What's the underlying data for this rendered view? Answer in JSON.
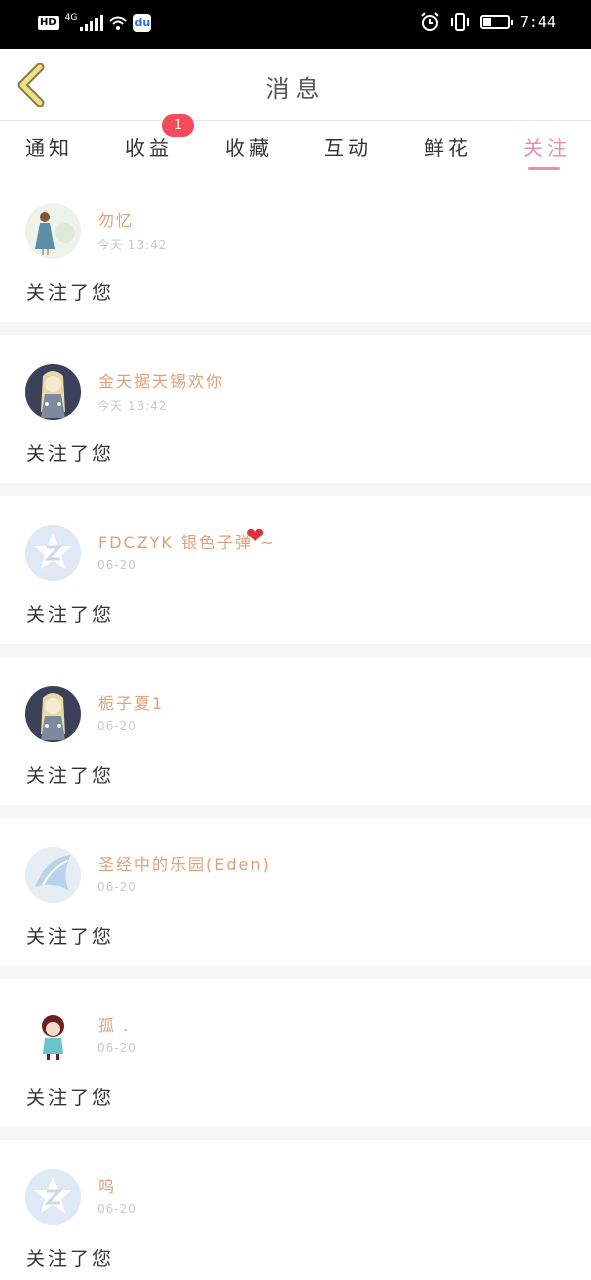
{
  "status_bar": {
    "hd": "HD",
    "network": "4G",
    "time": "7:44",
    "battery_level": 0.35,
    "icons": [
      "signal-icon",
      "wifi-icon",
      "baidu-app-icon",
      "alarm-icon",
      "vibrate-icon",
      "battery-icon"
    ]
  },
  "header": {
    "title": "消息",
    "back_icon": "chevron-left-icon"
  },
  "tabs": [
    {
      "label": "通知",
      "active": false
    },
    {
      "label": "收益",
      "active": false,
      "badge": "1"
    },
    {
      "label": "收藏",
      "active": false
    },
    {
      "label": "互动",
      "active": false
    },
    {
      "label": "鲜花",
      "active": false
    },
    {
      "label": "关注",
      "active": true
    }
  ],
  "colors": {
    "accent": "#e48fb2",
    "username": "#e0a07a",
    "timestamp": "#c9c9c9",
    "badge": "#f44a5a",
    "back_icon": "#d9c96a",
    "separator": "#f6f6f6"
  },
  "notifications": [
    {
      "username": "勿忆",
      "time": "今天 13:42",
      "message": "关注了您",
      "avatar": "girl-illustration"
    },
    {
      "username": "金天据天锡欢你",
      "time": "今天 13:42",
      "message": "关注了您",
      "avatar": "dark-illustration"
    },
    {
      "username": "FDCZYK 银色子弹 ~",
      "time": "06-20",
      "message": "关注了您",
      "avatar": "default-logo",
      "trailing_icon": "heart-icon"
    },
    {
      "username": "栀子夏1",
      "time": "06-20",
      "message": "关注了您",
      "avatar": "dark-illustration"
    },
    {
      "username": "圣经中的乐园(Eden)",
      "time": "06-20",
      "message": "关注了您",
      "avatar": "blue-wings"
    },
    {
      "username": "孤 .",
      "time": "06-20",
      "message": "关注了您",
      "avatar": "cartoon-girl"
    },
    {
      "username": "呜",
      "time": "06-20",
      "message": "关注了您",
      "avatar": "default-logo"
    }
  ]
}
